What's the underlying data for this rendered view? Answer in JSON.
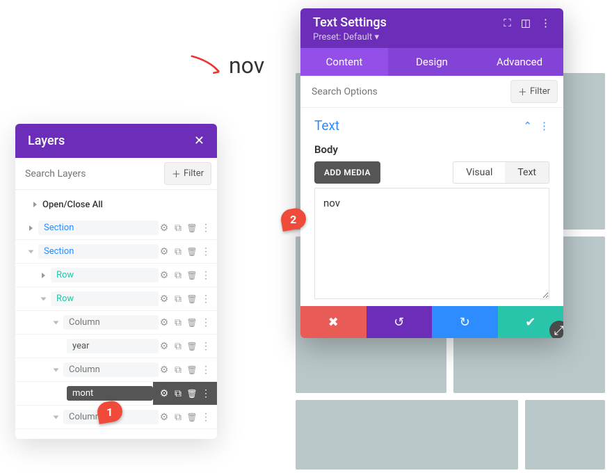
{
  "colors": {
    "brand_purple": "#6c2eb9",
    "brand_purple_light": "#934fe8",
    "link_blue": "#2d8cff",
    "teal": "#29c4a9",
    "danger": "#e85b56"
  },
  "preview_text": "nov",
  "layers": {
    "title": "Layers",
    "search_placeholder": "Search Layers",
    "filter_label": "Filter",
    "open_close_all": "Open/Close All",
    "items": [
      {
        "label": "Section",
        "kind": "section",
        "indent": 1,
        "expanded": false
      },
      {
        "label": "Section",
        "kind": "section",
        "indent": 1,
        "expanded": true
      },
      {
        "label": "Row",
        "kind": "row",
        "indent": 2,
        "expanded": false
      },
      {
        "label": "Row",
        "kind": "row",
        "indent": 2,
        "expanded": true
      },
      {
        "label": "Column",
        "kind": "column",
        "indent": 3,
        "expanded": true
      },
      {
        "label": "year",
        "kind": "module",
        "indent": 4,
        "active": false
      },
      {
        "label": "Column",
        "kind": "column",
        "indent": 3,
        "expanded": true
      },
      {
        "label": "mont",
        "kind": "module",
        "indent": 4,
        "active": true
      },
      {
        "label": "Column",
        "kind": "column",
        "indent": 3,
        "expanded": true
      }
    ]
  },
  "settings": {
    "title": "Text Settings",
    "preset": "Preset: Default",
    "tabs": [
      "Content",
      "Design",
      "Advanced"
    ],
    "active_tab": "Content",
    "search_placeholder": "Search Options",
    "filter_label": "Filter",
    "section_title": "Text",
    "body_label": "Body",
    "add_media": "ADD MEDIA",
    "editor_tabs": [
      "Visual",
      "Text"
    ],
    "editor_active": "Text",
    "editor_content": "nov"
  },
  "pins": {
    "one": "1",
    "two": "2"
  }
}
